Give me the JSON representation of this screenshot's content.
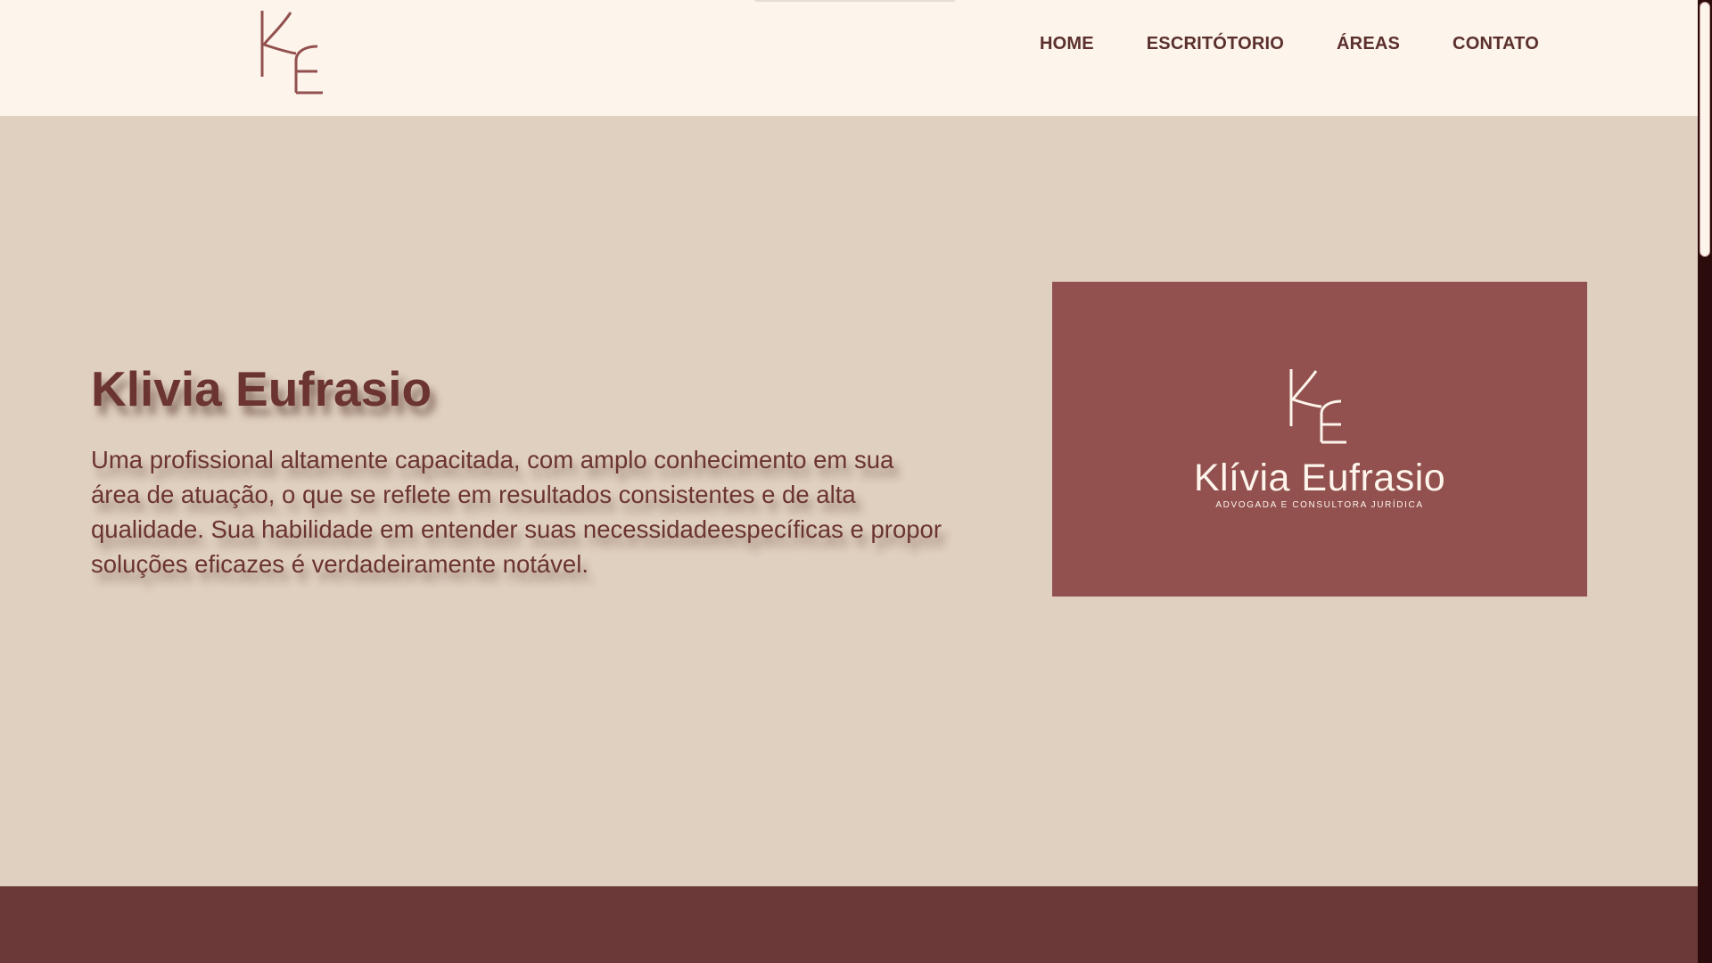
{
  "header": {
    "logo_letters": "KE",
    "nav": [
      {
        "label": "HOME"
      },
      {
        "label": "ESCRITÓTORIO"
      },
      {
        "label": "ÁREAS"
      },
      {
        "label": "CONTATO"
      }
    ]
  },
  "hero": {
    "title": "Klivia Eufrasio",
    "text": "Uma profissional altamente capacitada, com amplo conhecimento em sua área de atuação, o que se reflete em resultados consistentes e de alta qualidade. Sua habilidade em entender suas necessidadeespecíficas e propor soluções eficazes é verdadeiramente notável."
  },
  "logo_card": {
    "monogram": "KE",
    "name": "Klívia Eufrasio",
    "tagline": "ADVOGADA E CONSULTORA JURÍDICA"
  },
  "colors": {
    "header_bg": "#fdf4ec",
    "page_bg": "#e0d0c0",
    "accent": "#6b3430",
    "card_bg": "#92514e",
    "footer_bg": "#6b3937",
    "scrollbar_track": "#2b0b0b"
  },
  "icons": {
    "header_logo": "ke-monogram-icon",
    "card_logo": "ke-monogram-icon"
  }
}
